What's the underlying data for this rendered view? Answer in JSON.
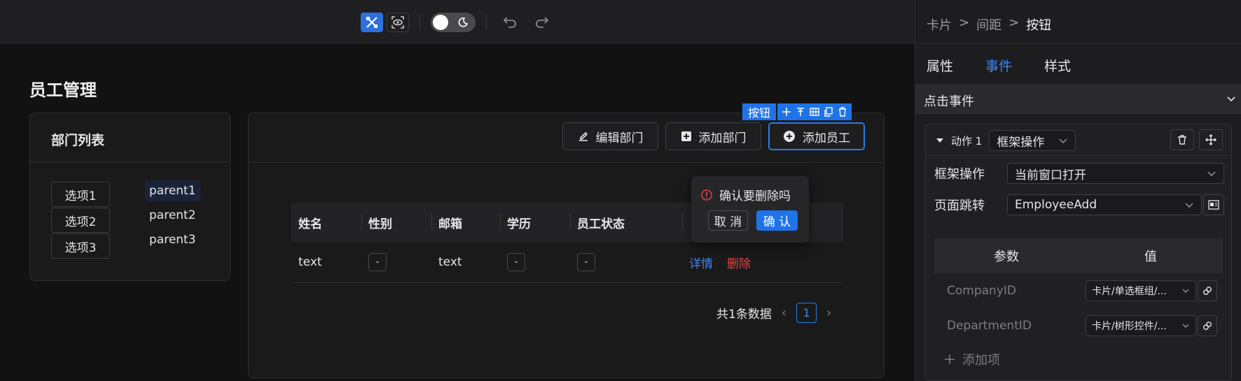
{
  "toolbar": {
    "undo": "undo",
    "redo": "redo"
  },
  "canvas": {
    "page_title": "员工管理",
    "dept_card": {
      "title": "部门列表",
      "options": [
        "选项1",
        "选项2",
        "选项3"
      ],
      "tree": [
        "parent1",
        "parent2",
        "parent3"
      ]
    },
    "emp_card": {
      "buttons": {
        "edit_dept": "编辑部门",
        "add_dept": "添加部门",
        "add_emp": "添加员工"
      },
      "selection_label": "按钮",
      "columns": [
        "姓名",
        "性别",
        "邮箱",
        "学历",
        "员工状态"
      ],
      "rows": [
        {
          "name": "text",
          "gender": "-",
          "email": "text",
          "edu": "-",
          "status": "-",
          "detail": "详情",
          "delete": "删除"
        }
      ],
      "popconfirm": {
        "message": "确认要删除吗",
        "cancel": "取 消",
        "ok": "确 认"
      },
      "pager": {
        "total": "共1条数据",
        "page": "1"
      }
    }
  },
  "panel": {
    "breadcrumb": [
      "卡片",
      ">",
      "间距",
      ">",
      "按钮"
    ],
    "tabs": [
      "属性",
      "事件",
      "样式"
    ],
    "active_tab": "事件",
    "section": "点击事件",
    "action": {
      "label": "动作 1",
      "type": "框架操作",
      "frame_op_label": "框架操作",
      "frame_op_value": "当前窗口打开",
      "page_jump_label": "页面跳转",
      "page_jump_value": "EmployeeAdd",
      "param_col": "参数",
      "value_col": "值",
      "params": [
        {
          "name": "CompanyID",
          "value": "卡片/单选框组/..."
        },
        {
          "name": "DepartmentID",
          "value": "卡片/树形控件/..."
        }
      ],
      "add_item": "添加项"
    }
  },
  "colors": {
    "accent": "#1f73e8",
    "danger": "#e2433f",
    "bg": "#121213"
  }
}
